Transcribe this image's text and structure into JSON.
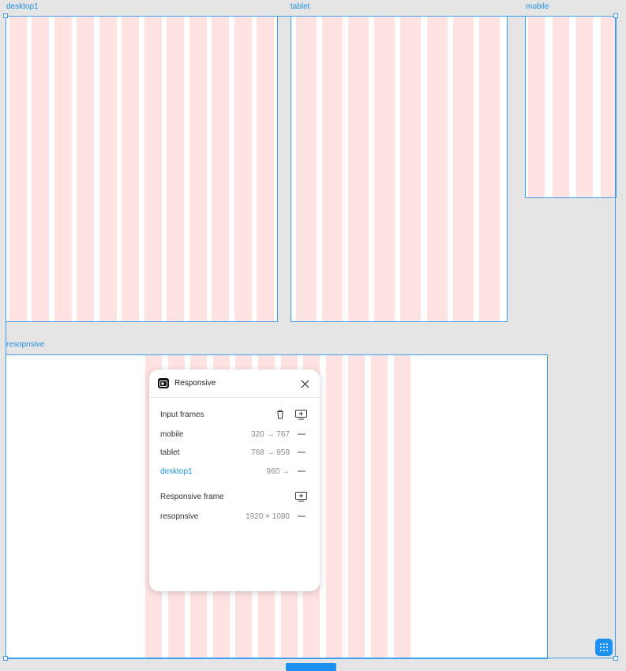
{
  "frames": {
    "desktop1": {
      "label": "desktop1"
    },
    "tablet": {
      "label": "tablet"
    },
    "mobile": {
      "label": "mobile"
    },
    "responsive": {
      "label": "resopnsive"
    }
  },
  "colors": {
    "accent": "#1e90f0",
    "grid_column": "#ffe3e3",
    "canvas": "#e5e5e5"
  },
  "panel": {
    "title": "Responsive",
    "icon": "responsive-plugin-icon",
    "input_frames": {
      "heading": "Input frames",
      "rows": [
        {
          "name": "mobile",
          "range": "320 → 767"
        },
        {
          "name": "tablet",
          "range": "768 → 959"
        },
        {
          "name": "desktop1",
          "range": "960 →"
        }
      ]
    },
    "responsive_frame": {
      "heading": "Responsive frame",
      "rows": [
        {
          "name": "resopnsive",
          "range": "1920 × 1080"
        }
      ]
    }
  }
}
